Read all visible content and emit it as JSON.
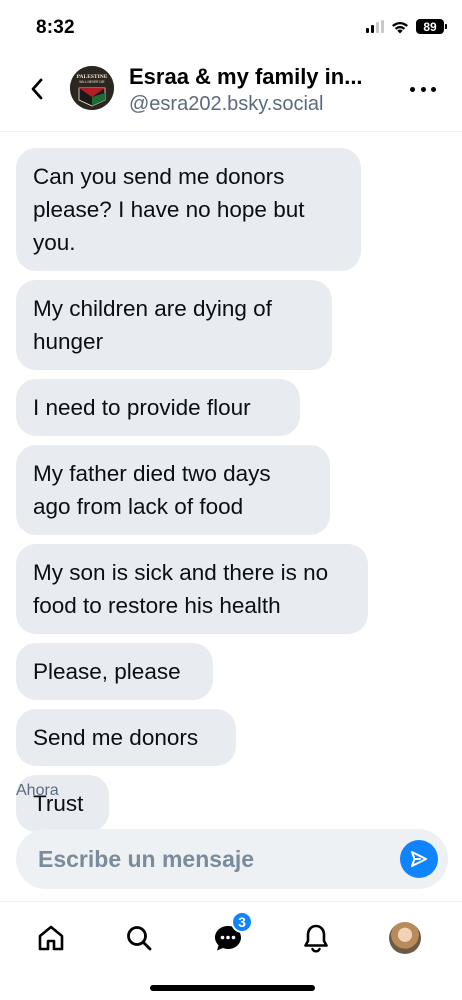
{
  "status_bar": {
    "time": "8:32",
    "battery": "89"
  },
  "header": {
    "title": "Esraa & my family in...",
    "handle": "@esra202.bsky.social",
    "avatar_text_line1": "PALESTINE",
    "avatar_text_line2": "WILL NEVER DIE"
  },
  "messages": [
    {
      "text": "Can you send me donors please? I have no hope but you."
    },
    {
      "text": "My children are dying of hunger"
    },
    {
      "text": "I need to provide flour"
    },
    {
      "text": "My father died two days ago from lack of food"
    },
    {
      "text": "My son is sick and there is no food to restore his health"
    },
    {
      "text": "Please, please"
    },
    {
      "text": "Send me donors"
    },
    {
      "text": "Trust"
    }
  ],
  "timestamp": "Ahora",
  "composer": {
    "placeholder": "Escribe un mensaje"
  },
  "bottom_nav": {
    "chat_badge": "3"
  },
  "colors": {
    "accent": "#1083fe",
    "bubble": "#e8ecf0",
    "secondary_text": "#5b6b7e"
  }
}
